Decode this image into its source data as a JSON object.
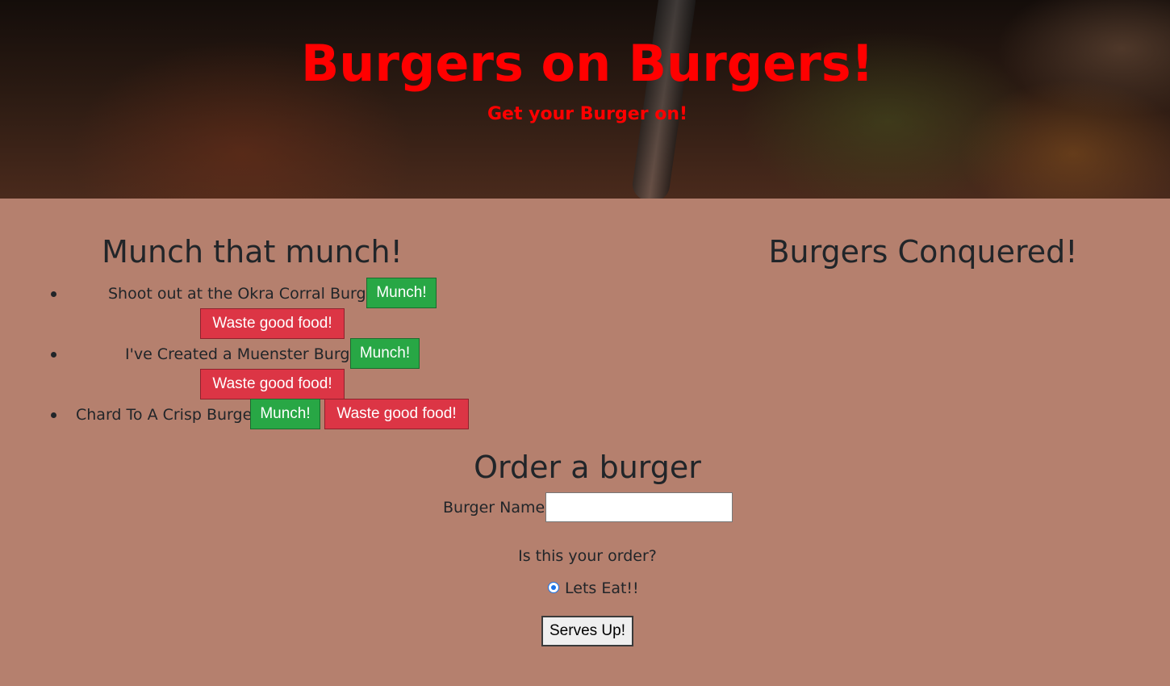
{
  "header": {
    "title": "Burgers on Burgers!",
    "subtitle": "Get your Burger on!"
  },
  "uneaten": {
    "heading": "Munch that munch!",
    "items": [
      {
        "name": "Shoot out at the Okra Corral Burger",
        "munch_label": "Munch!",
        "waste_label": "Waste good food!"
      },
      {
        "name": "I've Created a Muenster Burger",
        "munch_label": "Munch!",
        "waste_label": "Waste good food!"
      },
      {
        "name": "Chard To A Crisp Burger",
        "munch_label": "Munch!",
        "waste_label": "Waste good food!"
      }
    ]
  },
  "eaten": {
    "heading": "Burgers Conquered!"
  },
  "order": {
    "heading": "Order a burger",
    "name_label": "Burger Name:",
    "name_value": "",
    "question": "Is this your order?",
    "radio_label": "Lets Eat!!",
    "radio_checked": true,
    "submit_label": "Serves Up!"
  },
  "colors": {
    "page_background": "#b5806e",
    "title_red": "#ff0000",
    "munch_green": "#28a745",
    "waste_red": "#dc3545"
  }
}
